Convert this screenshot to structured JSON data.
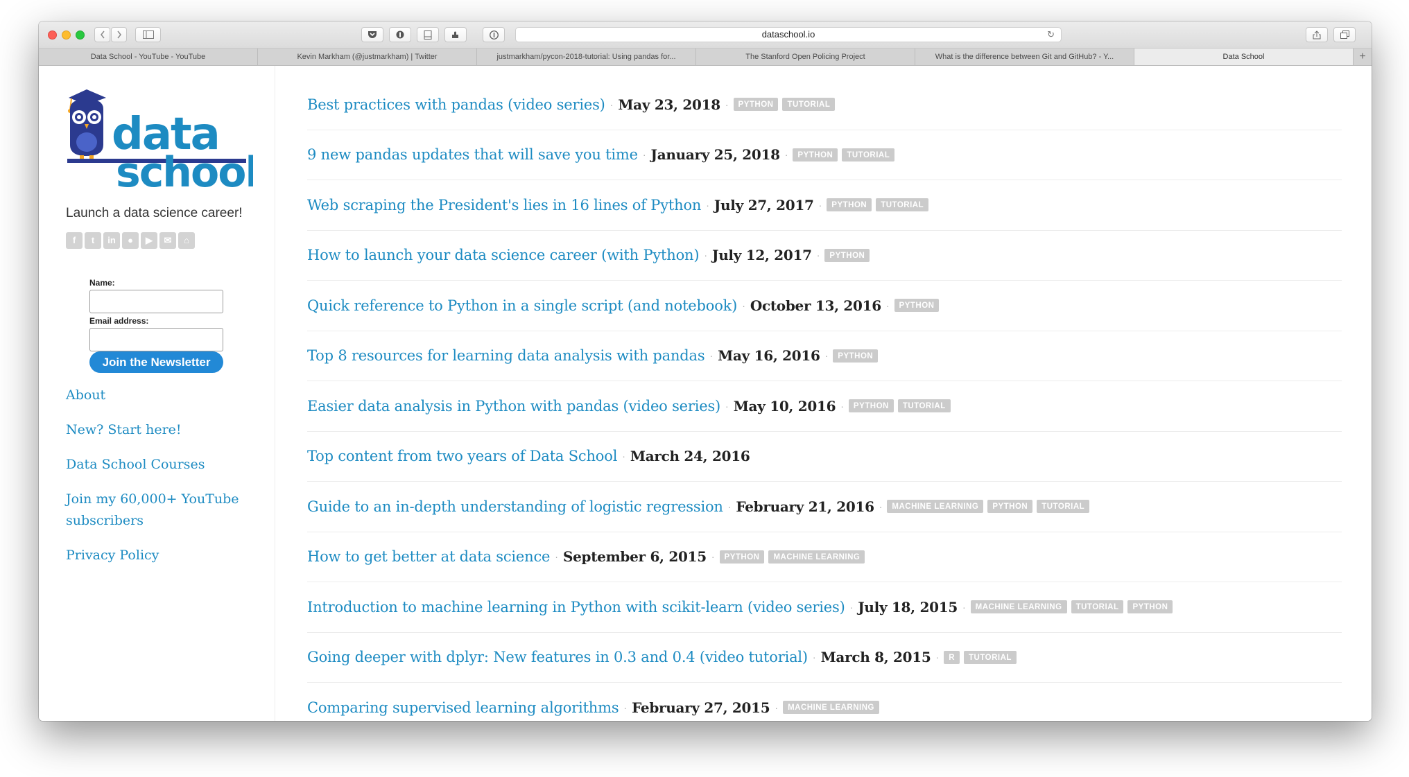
{
  "browser": {
    "url": "dataschool.io",
    "tabs": [
      {
        "label": "Data School - YouTube - YouTube",
        "active": false
      },
      {
        "label": "Kevin Markham (@justmarkham) | Twitter",
        "active": false
      },
      {
        "label": "justmarkham/pycon-2018-tutorial: Using pandas for...",
        "active": false
      },
      {
        "label": "The Stanford Open Policing Project",
        "active": false
      },
      {
        "label": "What is the difference between Git and GitHub? - Y...",
        "active": false
      },
      {
        "label": "Data School",
        "active": true
      }
    ],
    "new_tab": "+"
  },
  "sidebar": {
    "logo": {
      "line1": "data",
      "line2": "school"
    },
    "tagline": "Launch a data science career!",
    "social_icons": [
      "facebook-icon",
      "twitter-icon",
      "linkedin-icon",
      "github-icon",
      "youtube-icon",
      "email-icon",
      "rss-icon"
    ],
    "newsletter": {
      "name_label": "Name:",
      "name_value": "",
      "email_label": "Email address:",
      "email_value": "",
      "button": "Join the Newsletter"
    },
    "nav": [
      "About",
      "New? Start here!",
      "Data School Courses",
      "Join my 60,000+ YouTube subscribers",
      "Privacy Policy"
    ]
  },
  "posts": [
    {
      "title": "Best practices with pandas (video series)",
      "date": "May 23, 2018",
      "tags": [
        "PYTHON",
        "TUTORIAL"
      ]
    },
    {
      "title": "9 new pandas updates that will save you time",
      "date": "January 25, 2018",
      "tags": [
        "PYTHON",
        "TUTORIAL"
      ]
    },
    {
      "title": "Web scraping the President's lies in 16 lines of Python",
      "date": "July 27, 2017",
      "tags": [
        "PYTHON",
        "TUTORIAL"
      ]
    },
    {
      "title": "How to launch your data science career (with Python)",
      "date": "July 12, 2017",
      "tags": [
        "PYTHON"
      ]
    },
    {
      "title": "Quick reference to Python in a single script (and notebook)",
      "date": "October 13, 2016",
      "tags": [
        "PYTHON"
      ]
    },
    {
      "title": "Top 8 resources for learning data analysis with pandas",
      "date": "May 16, 2016",
      "tags": [
        "PYTHON"
      ]
    },
    {
      "title": "Easier data analysis in Python with pandas (video series)",
      "date": "May 10, 2016",
      "tags": [
        "PYTHON",
        "TUTORIAL"
      ]
    },
    {
      "title": "Top content from two years of Data School",
      "date": "March 24, 2016",
      "tags": []
    },
    {
      "title": "Guide to an in-depth understanding of logistic regression",
      "date": "February 21, 2016",
      "tags": [
        "MACHINE LEARNING",
        "PYTHON",
        "TUTORIAL"
      ]
    },
    {
      "title": "How to get better at data science",
      "date": "September 6, 2015",
      "tags": [
        "PYTHON",
        "MACHINE LEARNING"
      ]
    },
    {
      "title": "Introduction to machine learning in Python with scikit-learn (video series)",
      "date": "July 18, 2015",
      "tags": [
        "MACHINE LEARNING",
        "TUTORIAL",
        "PYTHON"
      ]
    },
    {
      "title": "Going deeper with dplyr: New features in 0.3 and 0.4 (video tutorial)",
      "date": "March 8, 2015",
      "tags": [
        "R",
        "TUTORIAL"
      ]
    },
    {
      "title": "Comparing supervised learning algorithms",
      "date": "February 27, 2015",
      "tags": [
        "MACHINE LEARNING"
      ]
    }
  ],
  "colors": {
    "link": "#1d8bc2",
    "button": "#2289d6",
    "tag": "#cbcbcb",
    "logo_navy": "#2b3a8f"
  }
}
